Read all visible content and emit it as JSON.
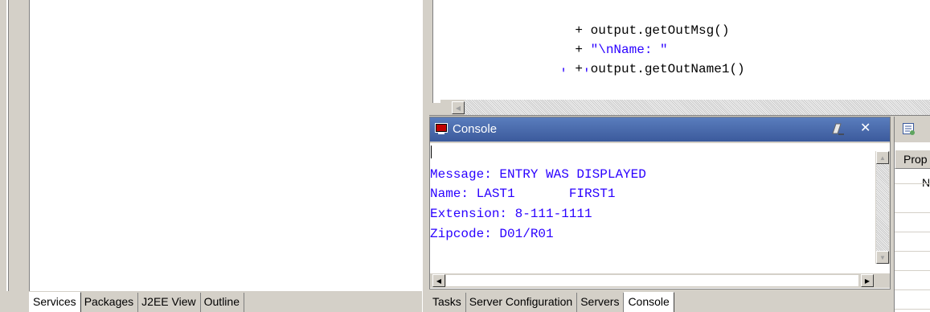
{
  "left_panel": {
    "tabs": [
      {
        "label": "Services",
        "active": true
      },
      {
        "label": "Packages",
        "active": false
      },
      {
        "label": "J2EE View",
        "active": false
      },
      {
        "label": "Outline",
        "active": false
      }
    ]
  },
  "editor": {
    "lines": [
      {
        "op": "+ ",
        "text": "output.getOutMsg()",
        "kind": "code"
      },
      {
        "op": "+ ",
        "text": "\"\\nName: \"",
        "kind": "string"
      },
      {
        "op": "+ ",
        "text": "output.getOutName1()",
        "kind": "code"
      }
    ]
  },
  "console": {
    "title": "Console",
    "icon": "console-monitor-icon",
    "output": [
      "Message: ENTRY WAS DISPLAYED",
      "Name: LAST1       FIRST1",
      "Extension: 8-111-1111",
      "Zipcode: D01/R01"
    ],
    "clear_icon": "eraser-icon",
    "close_icon": "close-icon",
    "text_color": "#2a00ff"
  },
  "properties": {
    "header": "Prop",
    "first_cell": "N",
    "icon": "properties-icon"
  },
  "bottom_panel": {
    "tabs": [
      {
        "label": "Tasks",
        "active": false
      },
      {
        "label": "Server Configuration",
        "active": false
      },
      {
        "label": "Servers",
        "active": false
      },
      {
        "label": "Console",
        "active": true
      }
    ]
  },
  "colors": {
    "title_bar": "#3b5a9c",
    "string_literal": "#2a00ff",
    "chrome": "#d4d0c8"
  }
}
